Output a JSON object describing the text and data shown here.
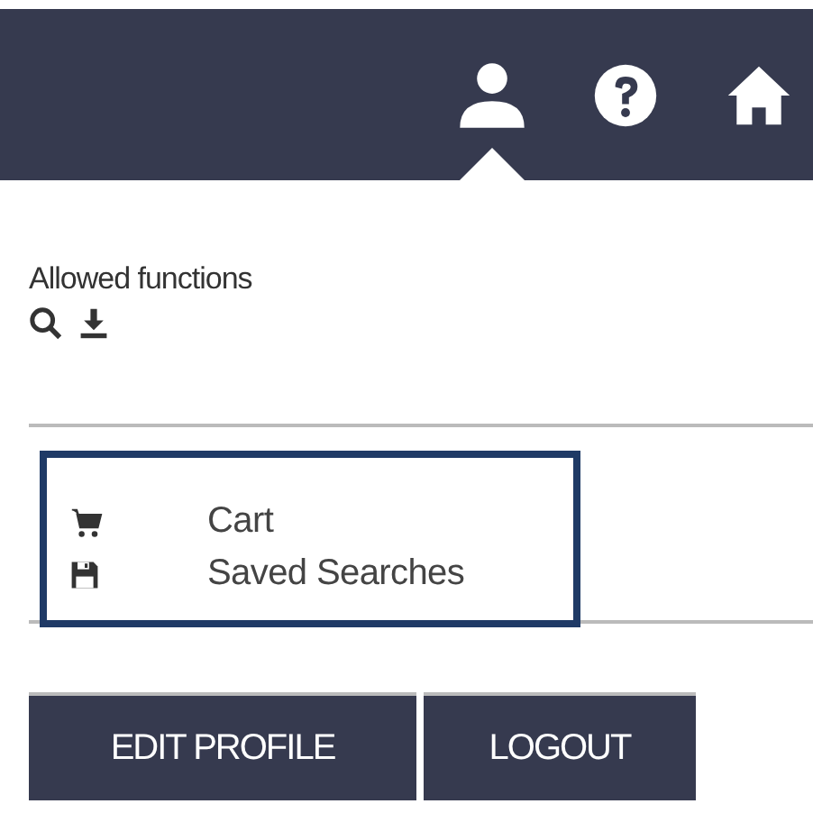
{
  "header": {
    "icons": [
      {
        "kind": "user",
        "selected": true
      },
      {
        "kind": "help",
        "selected": false
      },
      {
        "kind": "home",
        "selected": false
      }
    ]
  },
  "allowed_functions": {
    "label": "Allowed functions",
    "icons": [
      {
        "kind": "search"
      },
      {
        "kind": "download"
      }
    ]
  },
  "menu": [
    {
      "kind": "cart",
      "label": "Cart"
    },
    {
      "kind": "save",
      "label": "Saved Searches"
    }
  ],
  "buttons": [
    "EDIT PROFILE",
    "LOGOUT"
  ]
}
